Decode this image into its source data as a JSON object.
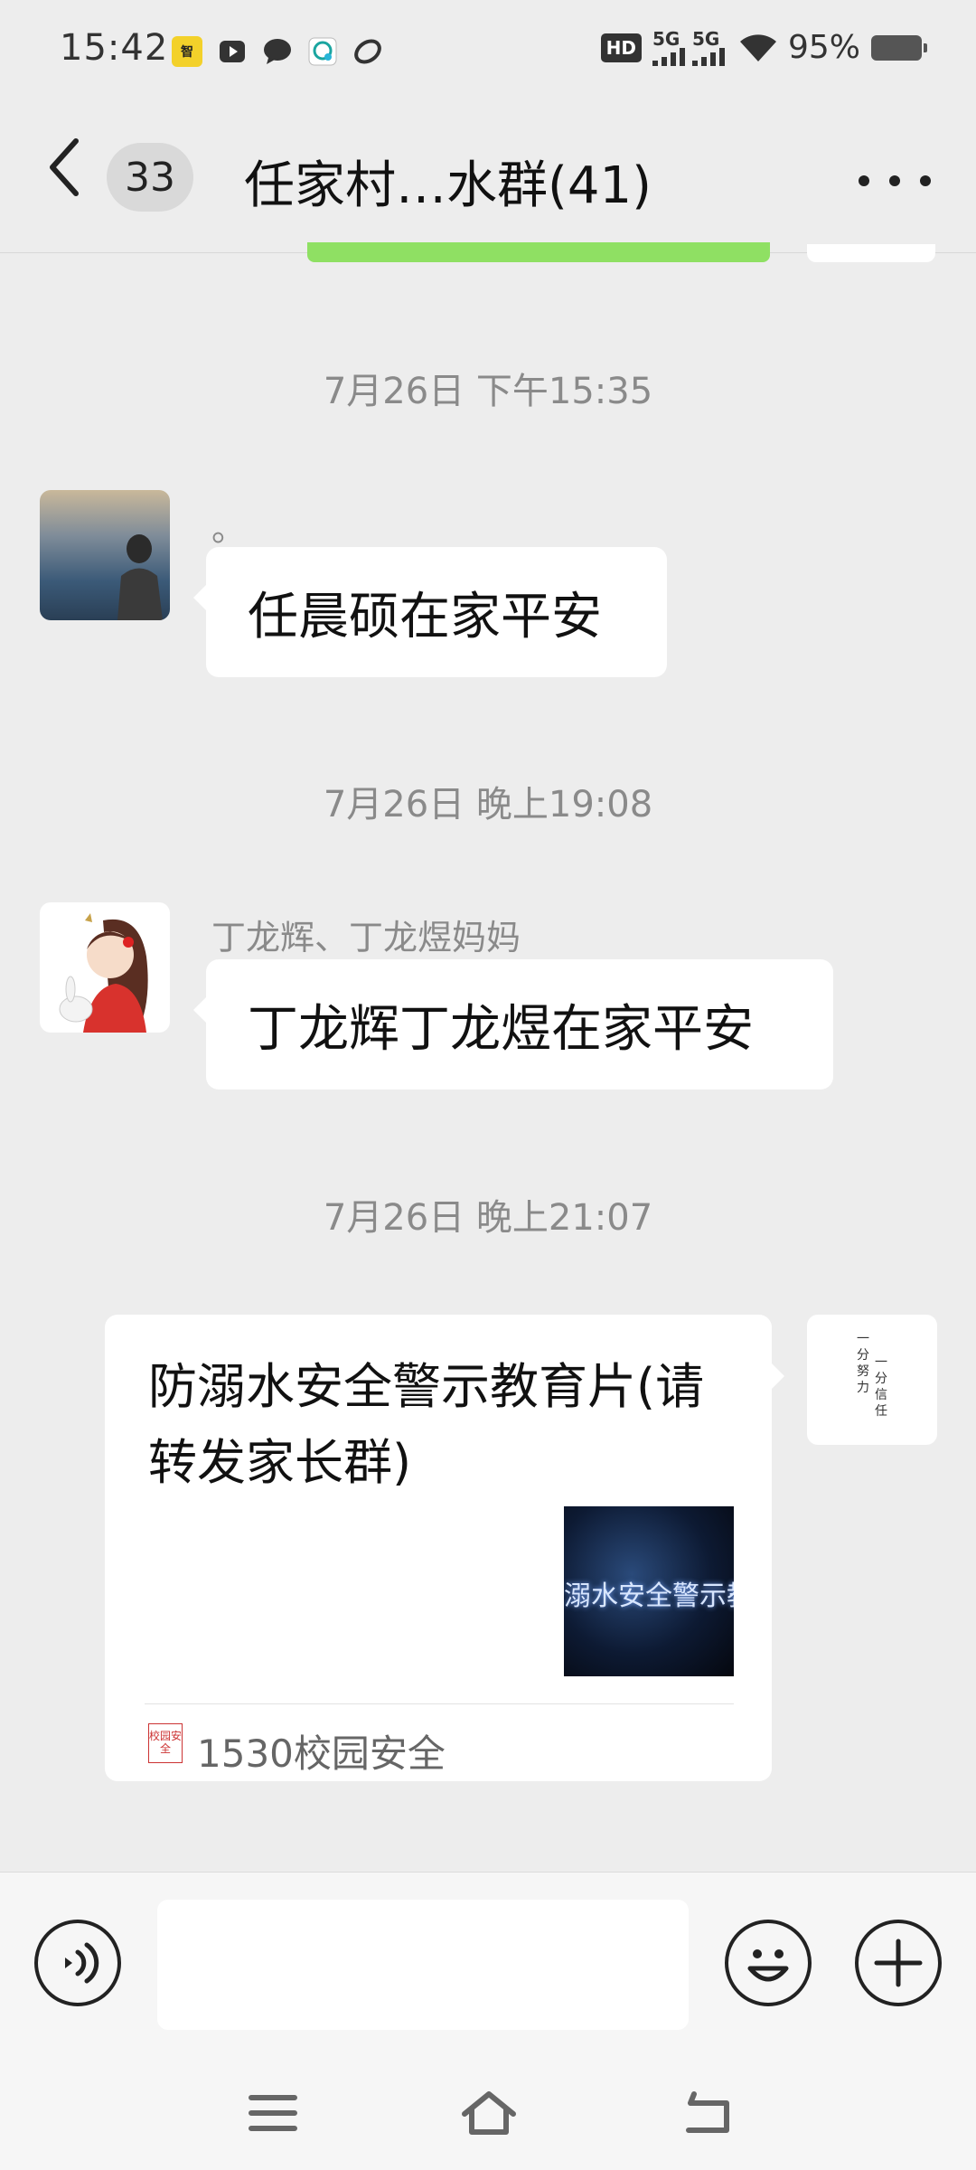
{
  "status_bar": {
    "time": "15:42",
    "network_1": "5G",
    "network_2": "5G",
    "hd_label": "HD",
    "battery": "95%",
    "icons": [
      "news-app-icon",
      "video-app-icon",
      "chat-bubble-icon",
      "message-app-icon",
      "link-app-icon",
      "hd-icon",
      "signal-icon",
      "wifi-icon",
      "battery-icon"
    ]
  },
  "header": {
    "unread_count": "33",
    "title": "任家村…水群(41)"
  },
  "messages": [
    {
      "timestamp": "7月26日 下午15:35",
      "sender": "。",
      "text": "任晨硕在家平安"
    },
    {
      "timestamp": "7月26日 晚上19:08",
      "sender": "丁龙辉、丁龙煜妈妈",
      "text": "丁龙辉丁龙煜在家平安"
    },
    {
      "timestamp": "7月26日 晚上21:07",
      "card": {
        "title": "防溺水安全警示教育片(请转发家长群)",
        "thumbnail_text": "溺水安全警示教育",
        "source_icon_text": "校园安全",
        "source": "1530校园安全"
      },
      "self_avatar_text": [
        "一分努力",
        "一分信任"
      ]
    }
  ],
  "input_bar": {
    "placeholder": ""
  },
  "colors": {
    "background": "#ededed",
    "bubble": "#ffffff",
    "green_bubble": "#8fe063",
    "timestamp": "#8a8a8a"
  }
}
